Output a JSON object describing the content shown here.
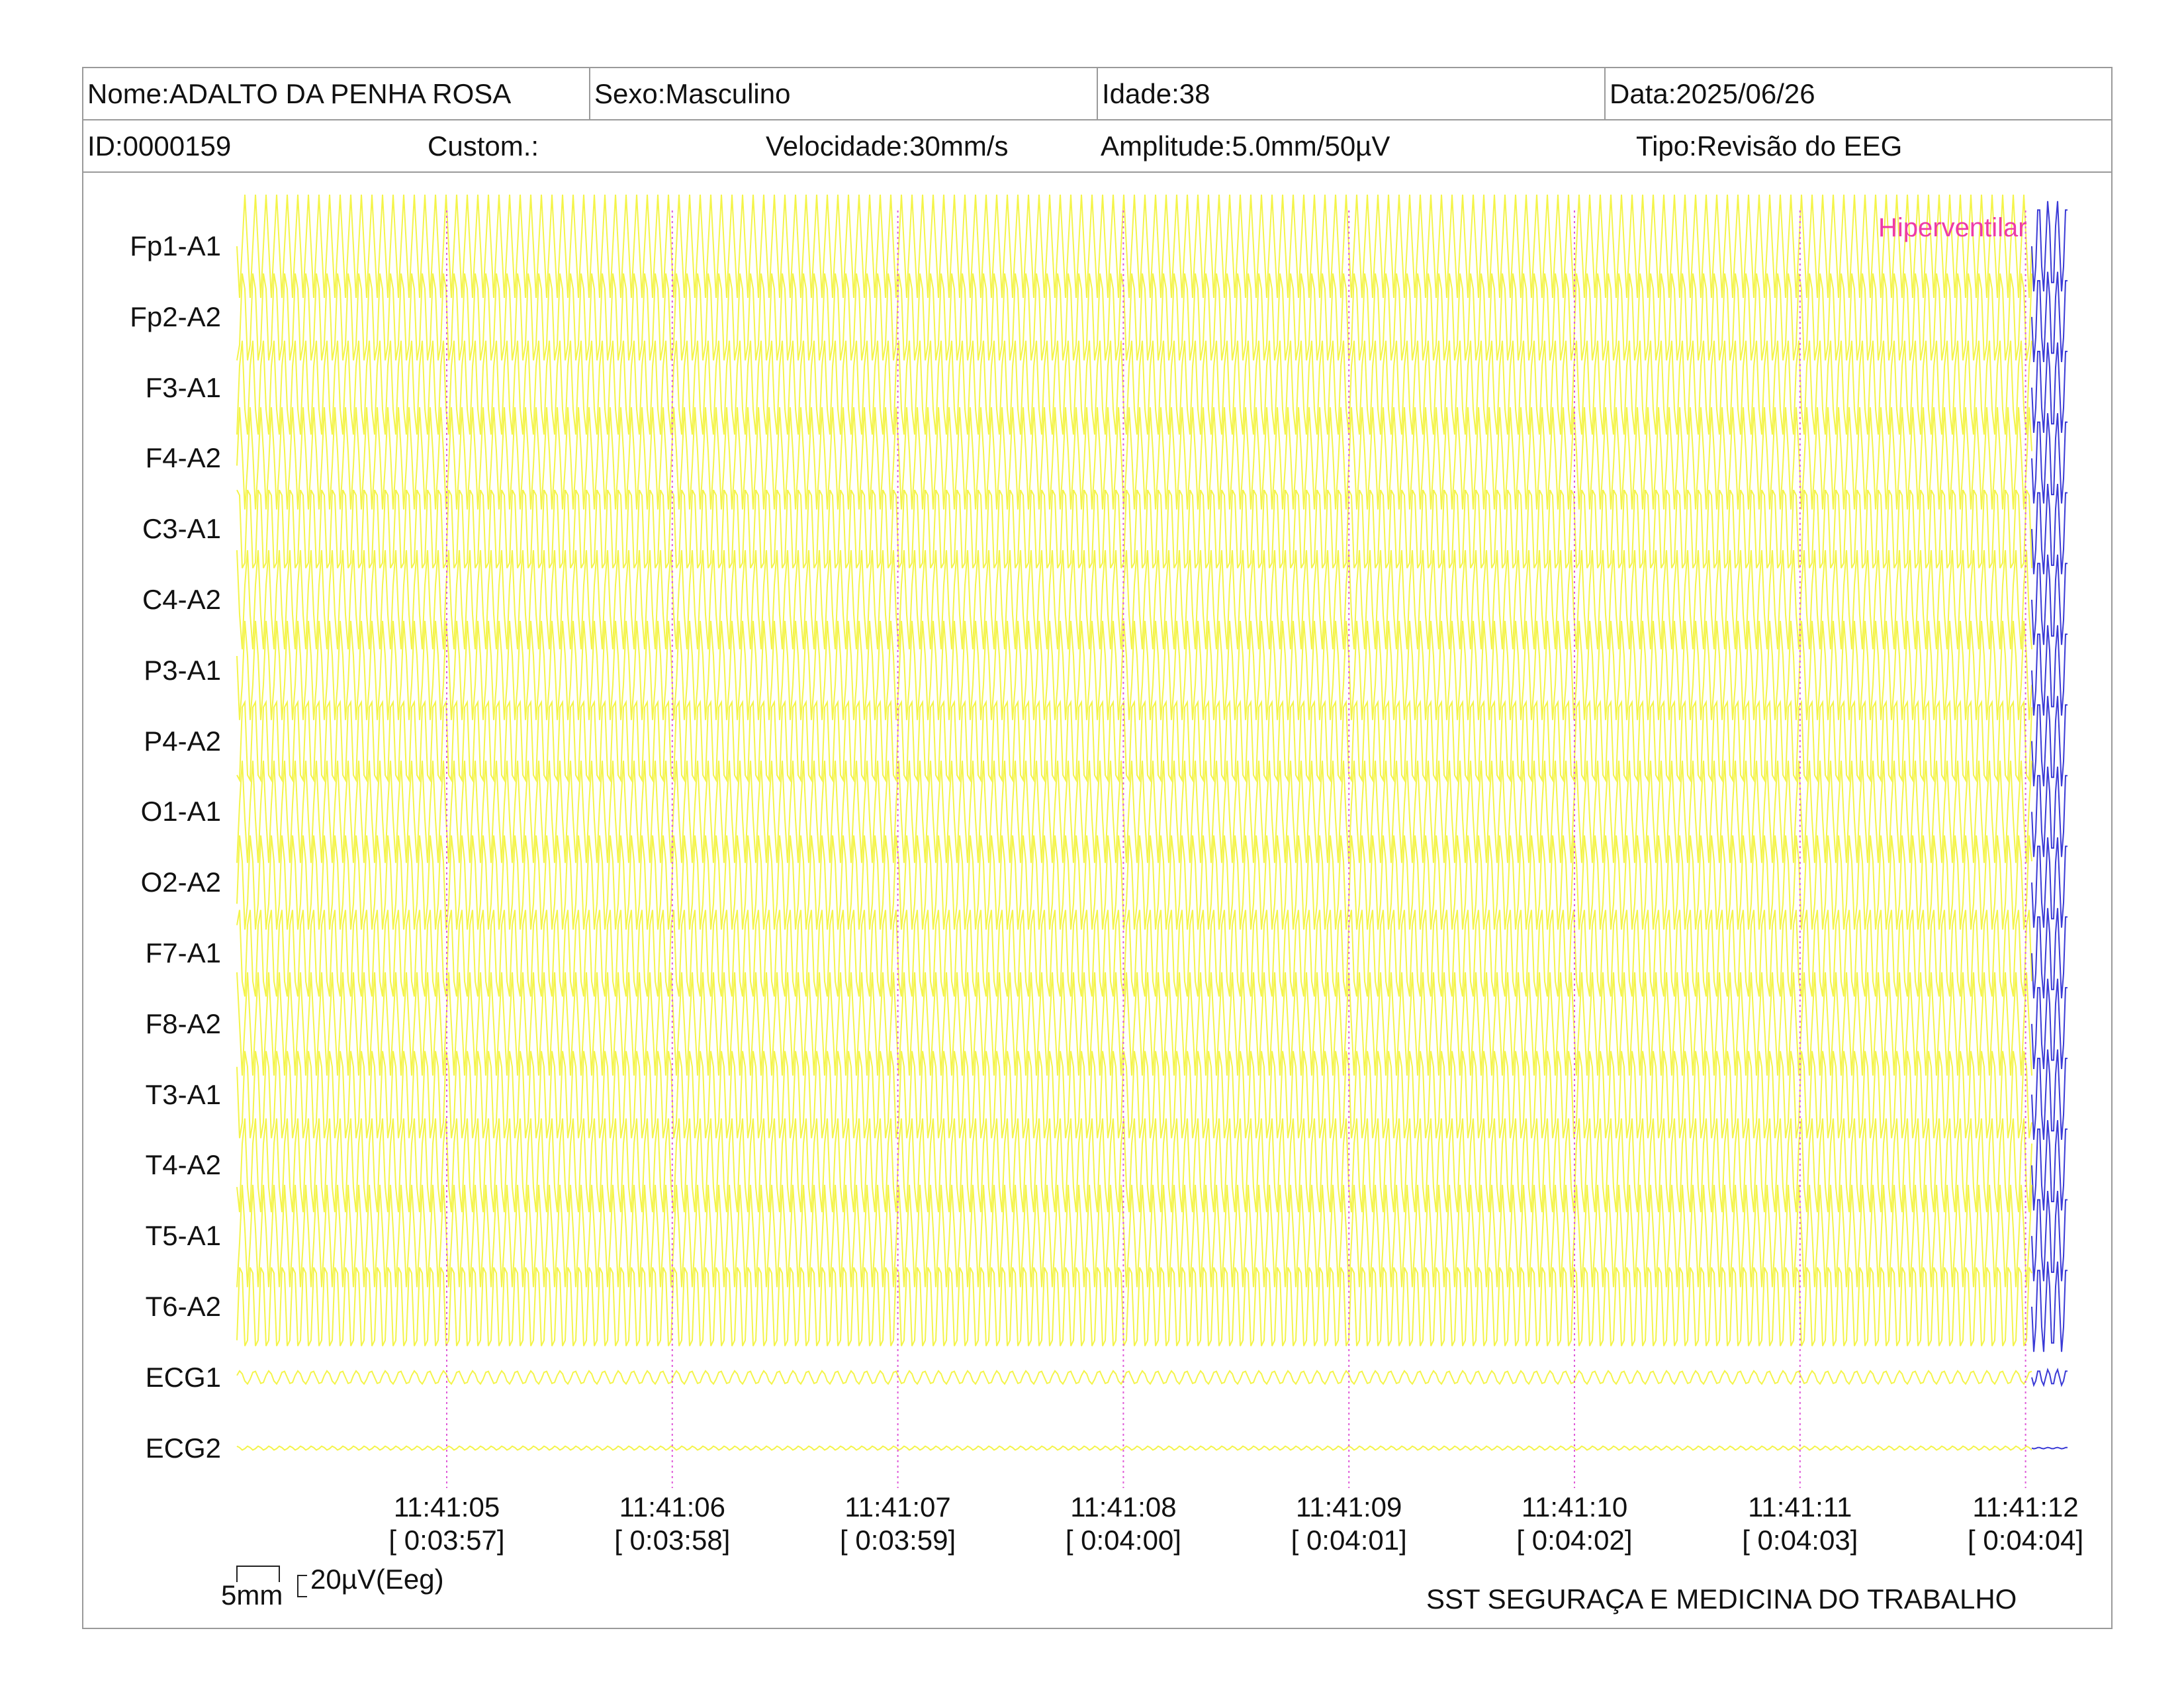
{
  "header": {
    "nome": "Nome:ADALTO DA PENHA ROSA",
    "sexo": "Sexo:Masculino",
    "idade": "Idade:38",
    "data": "Data:2025/06/26",
    "id": "ID:0000159",
    "custom": "Custom.:",
    "velocidade": "Velocidade:30mm/s",
    "amplitude": "Amplitude:5.0mm/50µV",
    "tipo": "Tipo:Revisão do EEG"
  },
  "channels": [
    "Fp1-A1",
    "Fp2-A2",
    "F3-A1",
    "F4-A2",
    "C3-A1",
    "C4-A2",
    "P3-A1",
    "P4-A2",
    "O1-A1",
    "O2-A2",
    "F7-A1",
    "F8-A2",
    "T3-A1",
    "T4-A2",
    "T5-A1",
    "T6-A2",
    "ECG1",
    "ECG2"
  ],
  "time_marks": [
    {
      "clock": "11:41:05",
      "elapsed": "[ 0:03:57]"
    },
    {
      "clock": "11:41:06",
      "elapsed": "[ 0:03:58]"
    },
    {
      "clock": "11:41:07",
      "elapsed": "[ 0:03:59]"
    },
    {
      "clock": "11:41:08",
      "elapsed": "[ 0:04:00]"
    },
    {
      "clock": "11:41:09",
      "elapsed": "[ 0:04:01]"
    },
    {
      "clock": "11:41:10",
      "elapsed": "[ 0:04:02]"
    },
    {
      "clock": "11:41:11",
      "elapsed": "[ 0:04:03]"
    },
    {
      "clock": "11:41:12",
      "elapsed": "[ 0:04:04]"
    }
  ],
  "event_label": "Hiperventilar",
  "scale": {
    "time": "5mm",
    "amplitude": "20µV(Eeg)"
  },
  "footer": "SST SEGURAÇA E MEDICINA DO TRABALHO",
  "colors": {
    "trace": "#f2f22a",
    "trace_tail": "#3a3ad6",
    "marker": "#e05ad8",
    "event": "#ee3aa8",
    "border": "#9a9a9a"
  }
}
